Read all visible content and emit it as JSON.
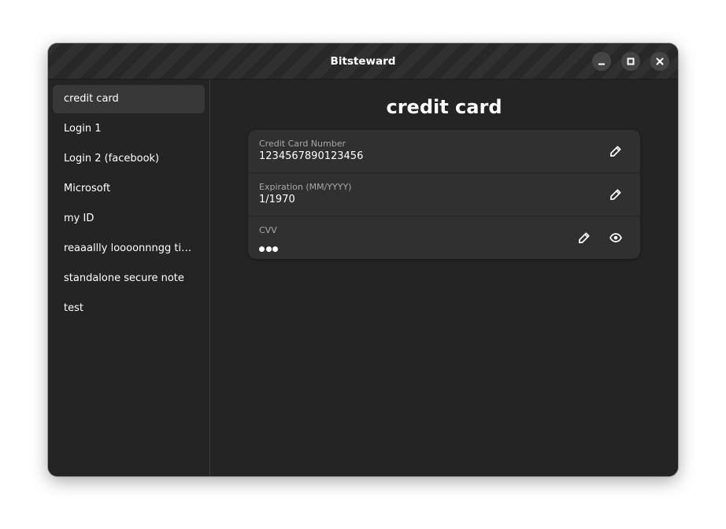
{
  "window": {
    "title": "Bitsteward",
    "controls": [
      "minimize-icon",
      "maximize-icon",
      "close-icon"
    ]
  },
  "sidebar": {
    "items": [
      {
        "label": "credit card",
        "selected": true
      },
      {
        "label": "Login 1",
        "selected": false
      },
      {
        "label": "Login 2 (facebook)",
        "selected": false
      },
      {
        "label": "Microsoft",
        "selected": false
      },
      {
        "label": "my ID",
        "selected": false
      },
      {
        "label": "reaaallly loooonnngg title ...",
        "selected": false
      },
      {
        "label": "standalone secure note",
        "selected": false
      },
      {
        "label": "test",
        "selected": false
      }
    ]
  },
  "main": {
    "title": "credit card",
    "fields": [
      {
        "label": "Credit Card Number",
        "value": "1234567890123456",
        "actions": [
          "pencil-icon"
        ]
      },
      {
        "label": "Expiration (MM/YYYY)",
        "value": "1/1970",
        "actions": [
          "pencil-icon"
        ]
      },
      {
        "label": "CVV",
        "value": "●●●",
        "masked": true,
        "actions": [
          "pencil-icon",
          "eye-icon"
        ]
      }
    ]
  },
  "colors": {
    "window_bg": "#242424",
    "headerbar_bg": "#2e2e2e",
    "card_bg": "#303030",
    "selected_row": "#383838",
    "text": "#ffffff",
    "secondary_text": "#a8a8a8"
  }
}
